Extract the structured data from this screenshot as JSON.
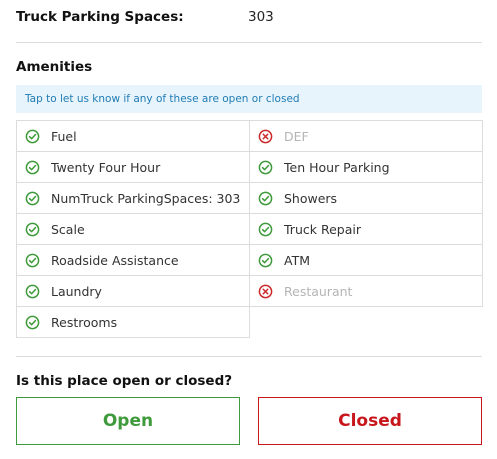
{
  "parking": {
    "label": "Truck Parking Spaces:",
    "value": "303"
  },
  "amenities": {
    "title": "Amenities",
    "banner": "Tap to let us know if any of these are open or closed",
    "left_column": [
      {
        "label": "Fuel",
        "status": "available",
        "icon": "check-circle-icon"
      },
      {
        "label": "Twenty Four Hour",
        "status": "available",
        "icon": "check-circle-icon"
      },
      {
        "label": "NumTruck ParkingSpaces: 303",
        "status": "available",
        "icon": "check-circle-icon"
      },
      {
        "label": "Scale",
        "status": "available",
        "icon": "check-circle-icon"
      },
      {
        "label": "Roadside Assistance",
        "status": "available",
        "icon": "check-circle-icon"
      },
      {
        "label": "Laundry",
        "status": "available",
        "icon": "check-circle-icon"
      },
      {
        "label": "Restrooms",
        "status": "available",
        "icon": "check-circle-icon"
      }
    ],
    "right_column": [
      {
        "label": "DEF",
        "status": "unavailable",
        "icon": "x-circle-icon"
      },
      {
        "label": "Ten Hour Parking",
        "status": "available",
        "icon": "check-circle-icon"
      },
      {
        "label": "Showers",
        "status": "available",
        "icon": "check-circle-icon"
      },
      {
        "label": "Truck Repair",
        "status": "available",
        "icon": "check-circle-icon"
      },
      {
        "label": "ATM",
        "status": "available",
        "icon": "check-circle-icon"
      },
      {
        "label": "Restaurant",
        "status": "unavailable",
        "icon": "x-circle-icon"
      }
    ]
  },
  "open_closed": {
    "question": "Is this place open or closed?",
    "open_label": "Open",
    "closed_label": "Closed"
  },
  "colors": {
    "available": "#3f9a3b",
    "unavailable": "#cc2a2a",
    "open": "#3f9a3b",
    "closed": "#c8161d",
    "banner_bg": "#e8f4fb",
    "banner_text": "#1f7cb5"
  }
}
